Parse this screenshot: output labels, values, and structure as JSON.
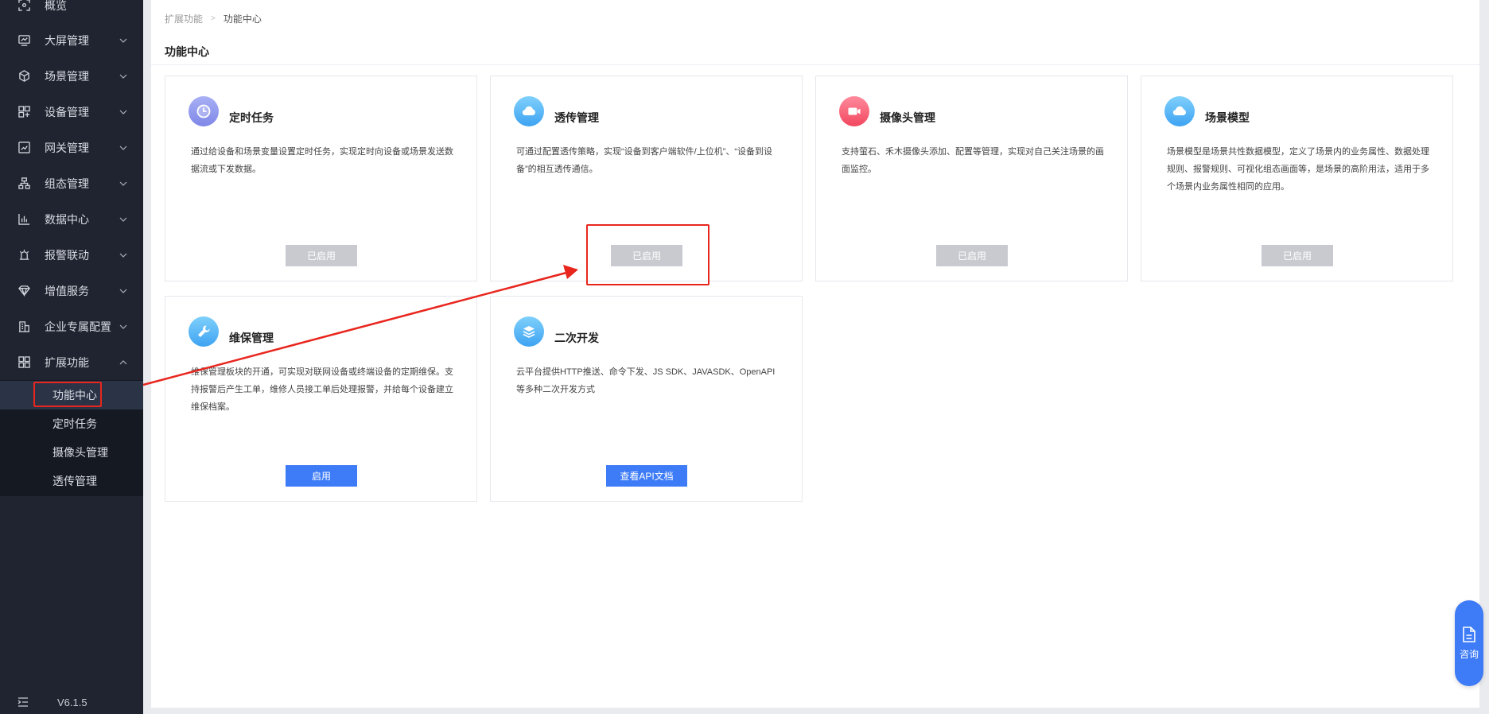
{
  "sidebar": {
    "items": [
      {
        "label": "概览",
        "icon": "overview-icon"
      },
      {
        "label": "大屏管理",
        "icon": "screen-icon"
      },
      {
        "label": "场景管理",
        "icon": "scene-icon"
      },
      {
        "label": "设备管理",
        "icon": "device-icon"
      },
      {
        "label": "网关管理",
        "icon": "gateway-icon"
      },
      {
        "label": "组态管理",
        "icon": "configuration-icon"
      },
      {
        "label": "数据中心",
        "icon": "data-icon"
      },
      {
        "label": "报警联动",
        "icon": "alarm-icon"
      },
      {
        "label": "增值服务",
        "icon": "diamond-icon"
      },
      {
        "label": "企业专属配置",
        "icon": "enterprise-icon"
      },
      {
        "label": "扩展功能",
        "icon": "grid-icon"
      }
    ],
    "submenu": [
      {
        "label": "功能中心"
      },
      {
        "label": "定时任务"
      },
      {
        "label": "摄像头管理"
      },
      {
        "label": "透传管理"
      }
    ],
    "version": "V6.1.5"
  },
  "breadcrumb": {
    "parent": "扩展功能",
    "current": "功能中心"
  },
  "page_title": "功能中心",
  "cards": [
    {
      "title": "定时任务",
      "desc": "通过给设备和场景变量设置定时任务，实现定时向设备或场景发送数据流或下发数据。",
      "button": "已启用",
      "icon": "clock-icon"
    },
    {
      "title": "透传管理",
      "desc": "可通过配置透传策略，实现“设备到客户端软件/上位机”、“设备到设备”的相互透传通信。",
      "button": "已启用",
      "icon": "cloud-icon"
    },
    {
      "title": "摄像头管理",
      "desc": "支持萤石、禾木摄像头添加、配置等管理，实现对自己关注场景的画面监控。",
      "button": "已启用",
      "icon": "camera-icon"
    },
    {
      "title": "场景模型",
      "desc": "场景模型是场景共性数据模型，定义了场景内的业务属性、数据处理规则、报警规则、可视化组态画面等，是场景的高阶用法，适用于多个场景内业务属性相同的应用。",
      "button": "已启用",
      "icon": "cloud-icon"
    },
    {
      "title": "维保管理",
      "desc": "维保管理板块的开通，可实现对联网设备或终端设备的定期维保。支持报警后产生工单，维修人员接工单后处理报警，并给每个设备建立维保档案。",
      "button": "启用",
      "icon": "wrench-icon"
    },
    {
      "title": "二次开发",
      "desc": "云平台提供HTTP推送、命令下发、JS SDK、JAVASDK、OpenAPI等多种二次开发方式",
      "button": "查看API文档",
      "icon": "layers-icon"
    }
  ],
  "consult": {
    "label": "咨询",
    "icon": "document-icon"
  },
  "colors": {
    "sidebar_bg": "#1f2430",
    "accent": "#3d7bf7",
    "disabled_button": "#c8cacf",
    "annotation": "#e8261e"
  }
}
